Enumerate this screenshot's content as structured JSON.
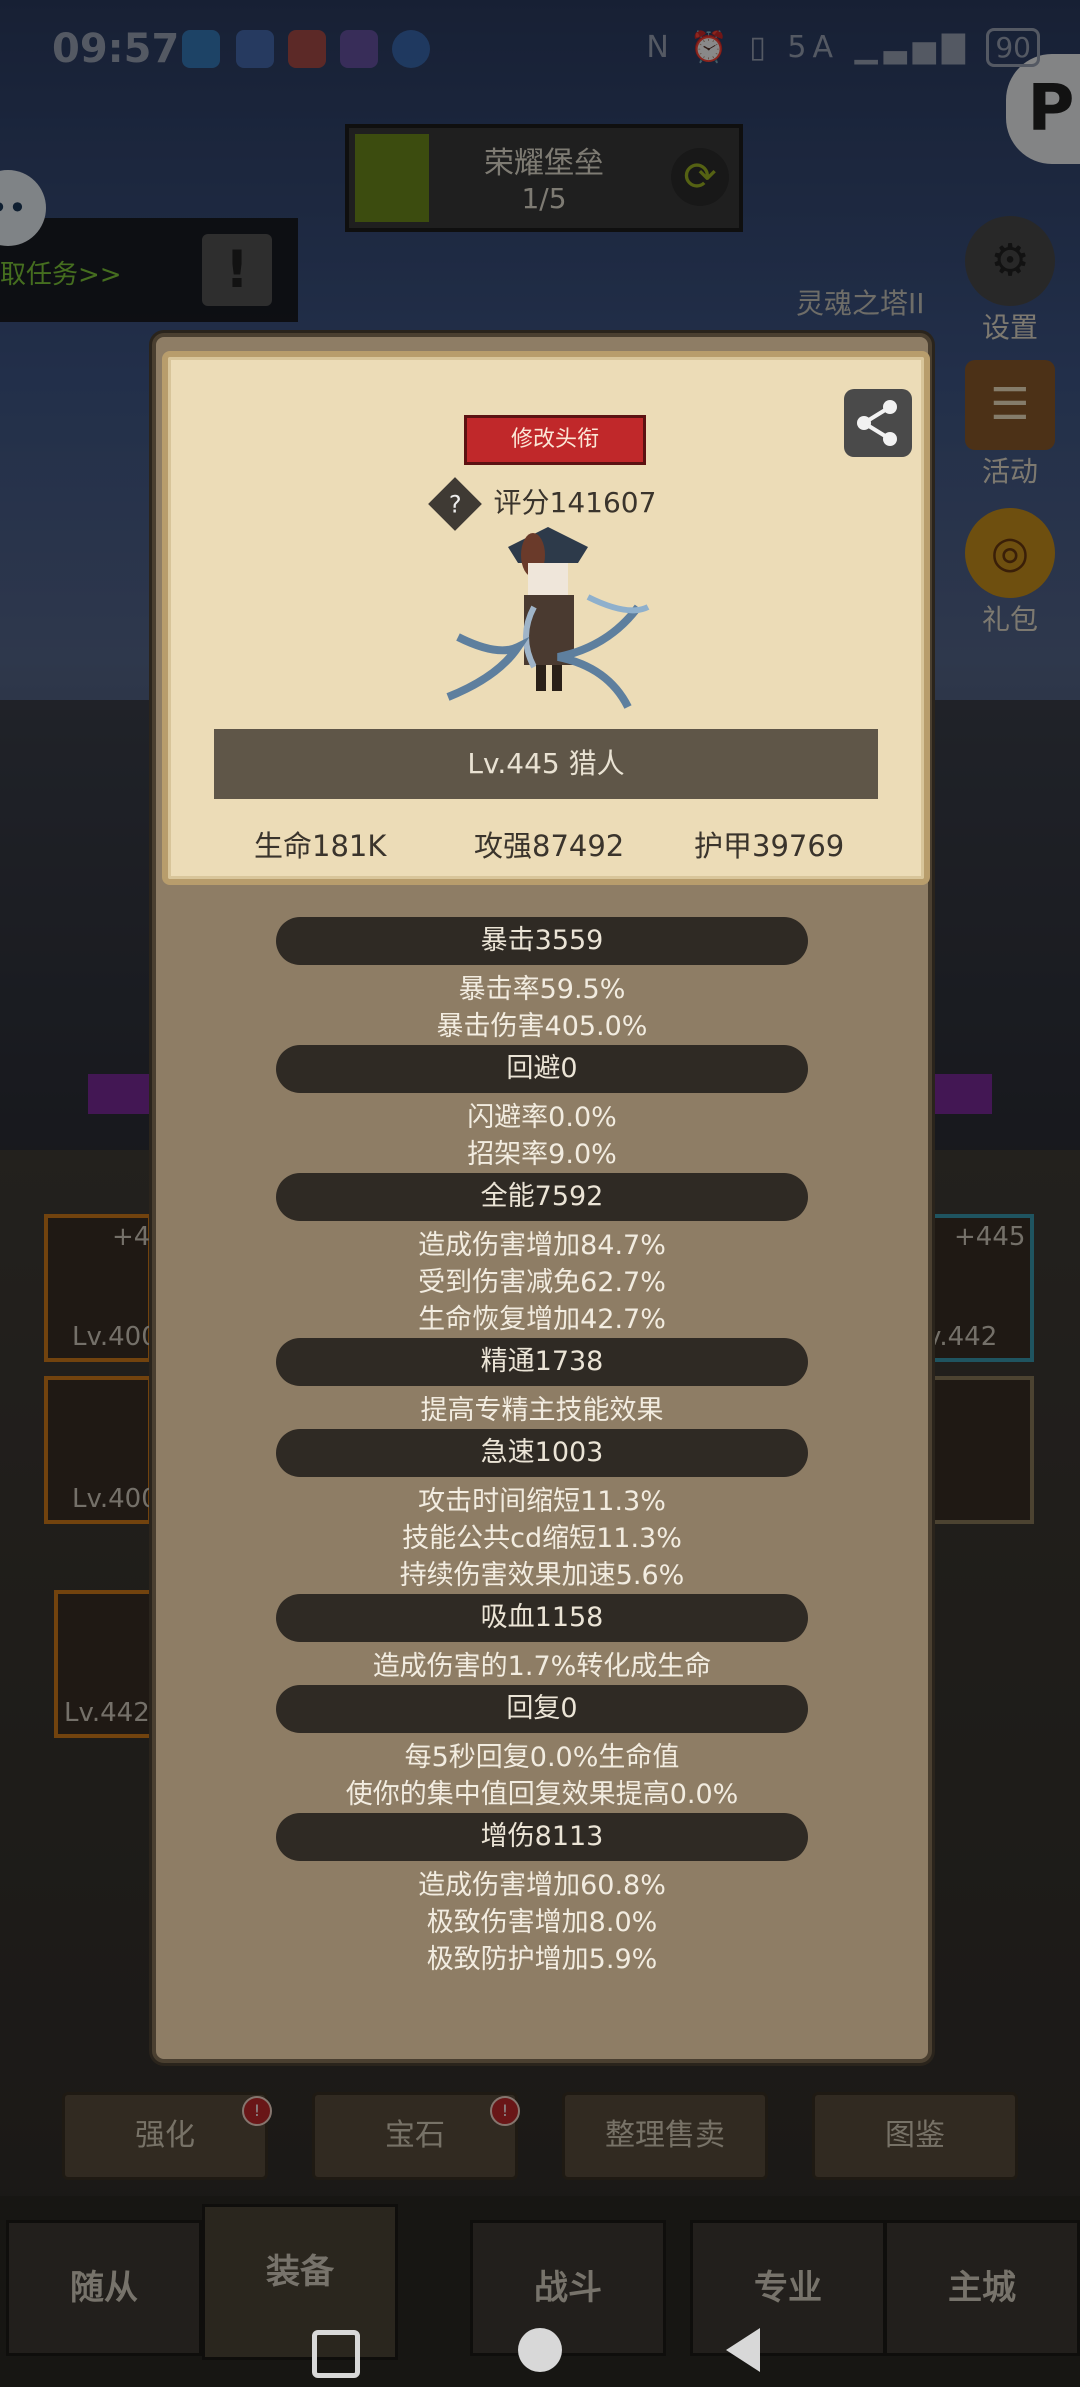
{
  "status_bar": {
    "time": "09:57",
    "network": "5A",
    "battery": "90"
  },
  "top": {
    "castle_title": "荣耀堡垒",
    "castle_progress": "1/5",
    "quest_text": "取任务>>",
    "tower_label": "灵魂之塔II",
    "settings_label": "设置",
    "activity_label": "活动",
    "gift_label": "礼包"
  },
  "profile": {
    "edit_title_button": "修改头衔",
    "score_label": "评分141607",
    "level_class": "Lv.445 猎人",
    "hp": "生命181K",
    "attack": "攻强87492",
    "armor": "护甲39769"
  },
  "stats": [
    {
      "header": "暴击3559",
      "lines": [
        "暴击率59.5%",
        "暴击伤害405.0%"
      ]
    },
    {
      "header": "回避0",
      "lines": [
        "闪避率0.0%",
        "招架率9.0%"
      ]
    },
    {
      "header": "全能7592",
      "lines": [
        "造成伤害增加84.7%",
        "受到伤害减免62.7%",
        "生命恢复增加42.7%"
      ]
    },
    {
      "header": "精通1738",
      "lines": [
        "提高专精主技能效果"
      ]
    },
    {
      "header": "急速1003",
      "lines": [
        "攻击时间缩短11.3%",
        "技能公共cd缩短11.3%",
        "持续伤害效果加速5.6%"
      ]
    },
    {
      "header": "吸血1158",
      "lines": [
        "造成伤害的1.7%转化成生命"
      ]
    },
    {
      "header": "回复0",
      "lines": [
        "每5秒回复0.0%生命值",
        "使你的集中值回复效果提高0.0%"
      ]
    },
    {
      "header": "增伤8113",
      "lines": [
        "造成伤害增加60.8%",
        "极致伤害增加8.0%",
        "极致防护增加5.9%"
      ]
    }
  ],
  "background_ui": {
    "slot_plus_left": "+4",
    "slot_lv_left1": "Lv.400",
    "slot_lv_left2": "Lv.400",
    "slot_lv_left3": "Lv.442",
    "slot_plus_right": "+445",
    "slot_lv_right": "v.442",
    "action_buttons": [
      "强化",
      "宝石",
      "整理售卖",
      "图鉴"
    ],
    "tabs": [
      "随从",
      "装备",
      "战斗",
      "专业",
      "主城"
    ]
  }
}
